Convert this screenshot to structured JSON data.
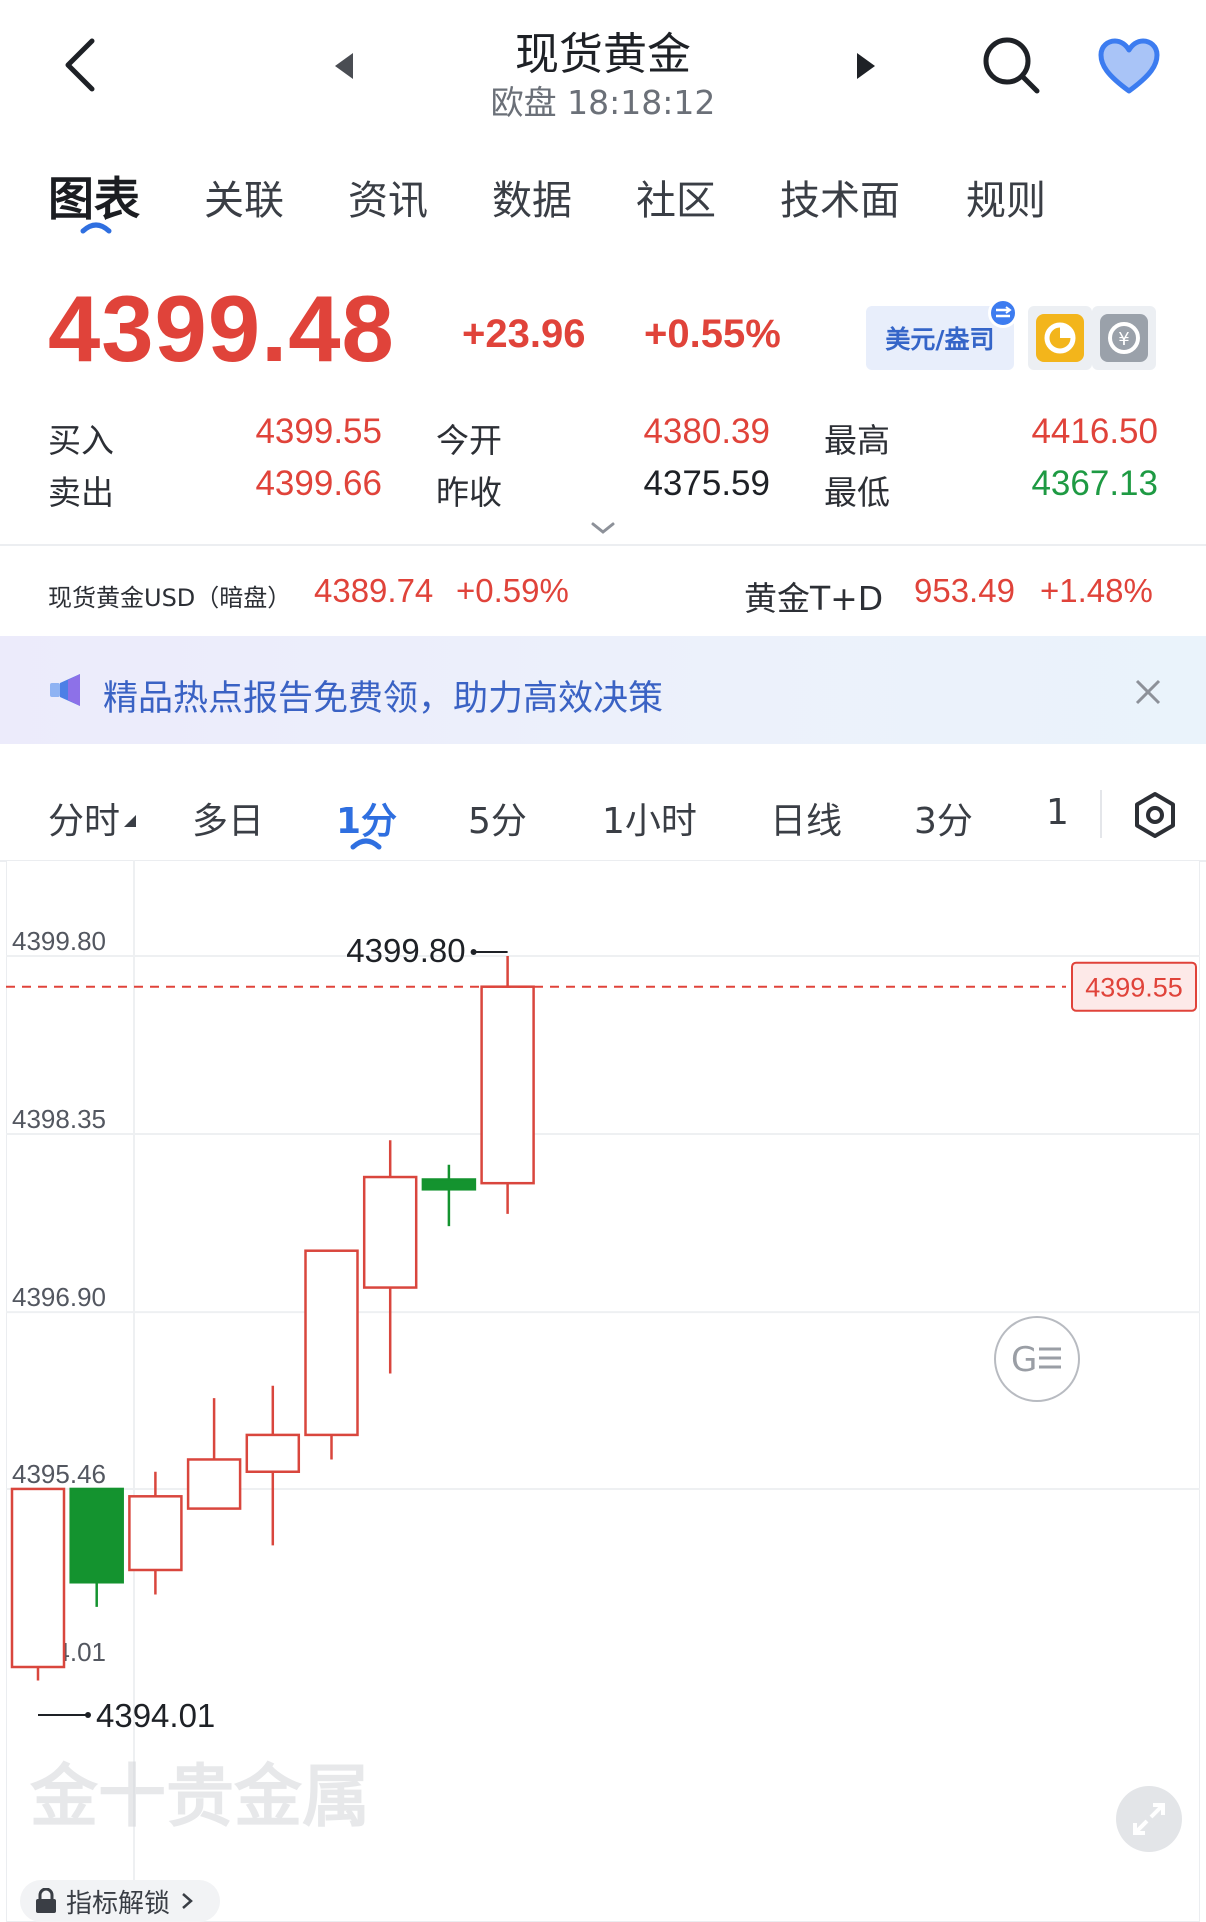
{
  "header": {
    "title": "现货黄金",
    "subtitle": "欧盘 18:18:12"
  },
  "tabs": [
    {
      "label": "图表",
      "active": true
    },
    {
      "label": "关联"
    },
    {
      "label": "资讯"
    },
    {
      "label": "数据"
    },
    {
      "label": "社区"
    },
    {
      "label": "技术面"
    },
    {
      "label": "规则"
    }
  ],
  "quote": {
    "price": "4399.48",
    "change": "+23.96",
    "change_pct": "+0.55%",
    "currency_unit": "美元/盎司",
    "bid_label": "买入",
    "bid": "4399.55",
    "ask_label": "卖出",
    "ask": "4399.66",
    "open_label": "今开",
    "open": "4380.39",
    "prev_close_label": "昨收",
    "prev_close": "4375.59",
    "high_label": "最高",
    "high": "4416.50",
    "low_label": "最低",
    "low": "4367.13"
  },
  "related": [
    {
      "name": "现货黄金USD（暗盘）",
      "price": "4389.74",
      "change_pct": "+0.59%"
    },
    {
      "name": "黄金T+D",
      "price": "953.49",
      "change_pct": "+1.48%"
    }
  ],
  "banner": {
    "text": "精品热点报告免费领，助力高效决策"
  },
  "periods": [
    {
      "label": "分时"
    },
    {
      "label": "多日"
    },
    {
      "label": "1分",
      "active": true
    },
    {
      "label": "5分"
    },
    {
      "label": "1小时"
    },
    {
      "label": "日线"
    },
    {
      "label": "3分"
    },
    {
      "label": "1"
    }
  ],
  "chart_data": {
    "type": "candlestick",
    "y_ticks": [
      "4399.80",
      "4398.35",
      "4396.90",
      "4395.46",
      "4394.01"
    ],
    "ylim": [
      4394.01,
      4399.8
    ],
    "current_price_line": "4399.55",
    "max_label": "4399.80",
    "min_label": "4394.01",
    "candles": [
      {
        "open": 4394.01,
        "close": 4395.46,
        "high": 4395.46,
        "low": 4393.9
      },
      {
        "open": 4395.46,
        "close": 4394.7,
        "high": 4395.46,
        "low": 4394.5
      },
      {
        "open": 4394.8,
        "close": 4395.4,
        "high": 4395.6,
        "low": 4394.6
      },
      {
        "open": 4395.3,
        "close": 4395.7,
        "high": 4396.2,
        "low": 4395.3
      },
      {
        "open": 4395.6,
        "close": 4395.9,
        "high": 4396.3,
        "low": 4395.0
      },
      {
        "open": 4395.9,
        "close": 4397.4,
        "high": 4397.4,
        "low": 4395.7
      },
      {
        "open": 4397.1,
        "close": 4398.0,
        "high": 4398.3,
        "low": 4396.4
      },
      {
        "open": 4397.98,
        "close": 4397.9,
        "high": 4398.1,
        "low": 4397.6
      },
      {
        "open": 4397.95,
        "close": 4399.55,
        "high": 4399.8,
        "low": 4397.7
      }
    ]
  },
  "watermark": "金十贵金属",
  "unlock_label": "指标解锁",
  "colors": {
    "up": "#d9463d",
    "down": "#14932f",
    "accent": "#2f6fe0"
  }
}
